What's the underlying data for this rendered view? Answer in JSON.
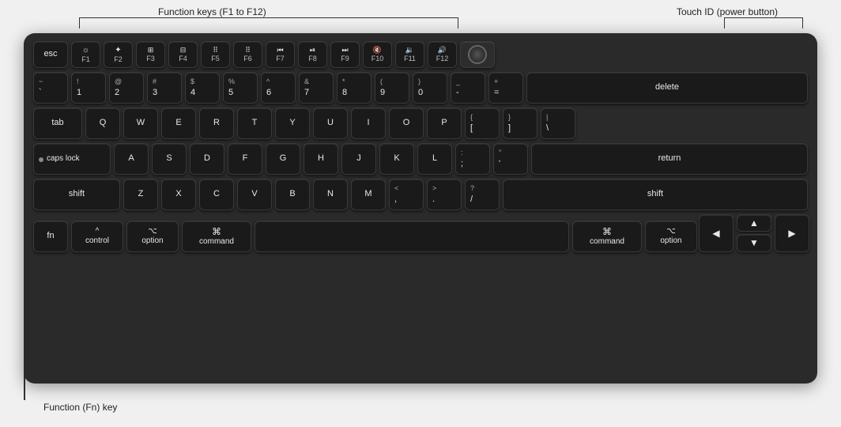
{
  "annotations": {
    "function_keys_label": "Function keys (F1 to F12)",
    "touchid_label": "Touch ID (power button)",
    "fn_key_label": "Function (Fn) key"
  },
  "keyboard": {
    "rows": {
      "fn_row": [
        "esc",
        "F1",
        "F2",
        "F3",
        "F4",
        "F5",
        "F6",
        "F7",
        "F8",
        "F9",
        "F10",
        "F11",
        "F12",
        "TouchID"
      ],
      "number_row": [
        "~`",
        "!1",
        "@2",
        "#3",
        "$4",
        "%5",
        "^6",
        "&7",
        "*8",
        "(9",
        ")0",
        "_-",
        "+=",
        "delete"
      ],
      "tab_row": [
        "tab",
        "Q",
        "W",
        "E",
        "R",
        "T",
        "Y",
        "U",
        "I",
        "O",
        "P",
        "{[",
        "}\\ ]",
        "|\\ \\"
      ],
      "caps_row": [
        "caps lock",
        "A",
        "S",
        "D",
        "F",
        "G",
        "H",
        "J",
        "K",
        "L",
        ":;",
        "\"'",
        "return"
      ],
      "shift_row": [
        "shift",
        "Z",
        "X",
        "C",
        "V",
        "B",
        "N",
        "M",
        "<,",
        ">.",
        "?/",
        "shift"
      ],
      "bottom_row": [
        "fn",
        "control",
        "option",
        "command",
        "space",
        "command",
        "option",
        "left",
        "up_down",
        "right"
      ]
    }
  }
}
